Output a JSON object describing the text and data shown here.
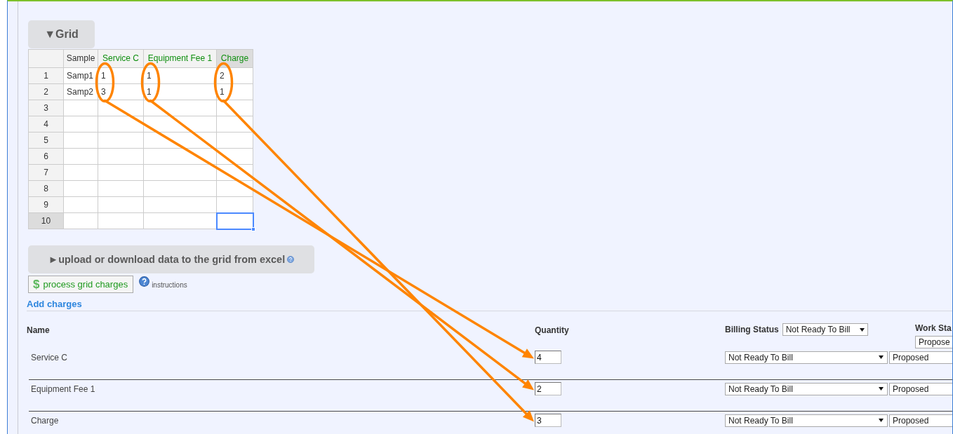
{
  "grid_section": {
    "toggle": {
      "label": "▼Grid"
    },
    "grid": {
      "columns": [
        {
          "label": "Sample",
          "kind": "sample",
          "selected": false,
          "circled": false
        },
        {
          "label": "Service C",
          "kind": "charge",
          "selected": false,
          "circled": true
        },
        {
          "label": "Equipment Fee 1",
          "kind": "charge",
          "selected": false,
          "circled": true
        },
        {
          "label": "Charge",
          "kind": "charge",
          "selected": true,
          "circled": true
        }
      ],
      "rows": [
        {
          "header": "1",
          "selected": false,
          "cells": [
            "Samp1",
            "1",
            "1",
            "2"
          ]
        },
        {
          "header": "2",
          "selected": false,
          "cells": [
            "Samp2",
            "3",
            "1",
            "1"
          ]
        },
        {
          "header": "3",
          "selected": false
        },
        {
          "header": "4",
          "selected": false
        },
        {
          "header": "5",
          "selected": false
        },
        {
          "header": "6",
          "selected": false
        },
        {
          "header": "7",
          "selected": false
        },
        {
          "header": "8",
          "selected": false
        },
        {
          "header": "9",
          "selected": false
        },
        {
          "header": "10",
          "selected": true
        }
      ]
    }
  },
  "excel_section": {
    "toggle": {
      "label": "►upload or download data to the grid from excel"
    }
  },
  "process_button": {
    "icon": "$",
    "label": "process grid charges"
  },
  "instructions": {
    "label": "instructions"
  },
  "charges": {
    "add_link": "Add charges",
    "headers": {
      "name": "Name",
      "quantity": "Quantity",
      "billing_status": "Billing Status",
      "work_status": "Work Sta"
    },
    "filters": {
      "billing_status": "Not Ready To Bill",
      "work_status": "Propose"
    },
    "rows": [
      {
        "name": "Service C",
        "quantity": "4",
        "billing_status": "Not Ready To Bill",
        "work_status": "Proposed"
      },
      {
        "name": "Equipment Fee 1",
        "quantity": "2",
        "billing_status": "Not Ready To Bill",
        "work_status": "Proposed"
      },
      {
        "name": "Charge",
        "quantity": "3",
        "billing_status": "Not Ready To Bill",
        "work_status": "Proposed"
      }
    ]
  }
}
